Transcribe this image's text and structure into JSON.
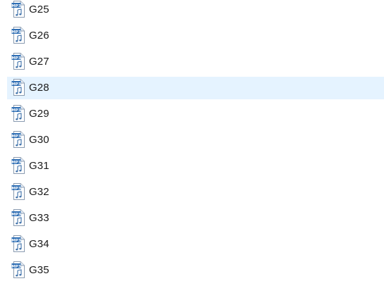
{
  "file_list": {
    "icon": "mp3-file-icon",
    "icon_badge": "MP3",
    "selected_index": 3,
    "items": [
      {
        "name": "G25"
      },
      {
        "name": "G26"
      },
      {
        "name": "G27"
      },
      {
        "name": "G28"
      },
      {
        "name": "G29"
      },
      {
        "name": "G30"
      },
      {
        "name": "G31"
      },
      {
        "name": "G32"
      },
      {
        "name": "G33"
      },
      {
        "name": "G34"
      },
      {
        "name": "G35"
      }
    ]
  }
}
